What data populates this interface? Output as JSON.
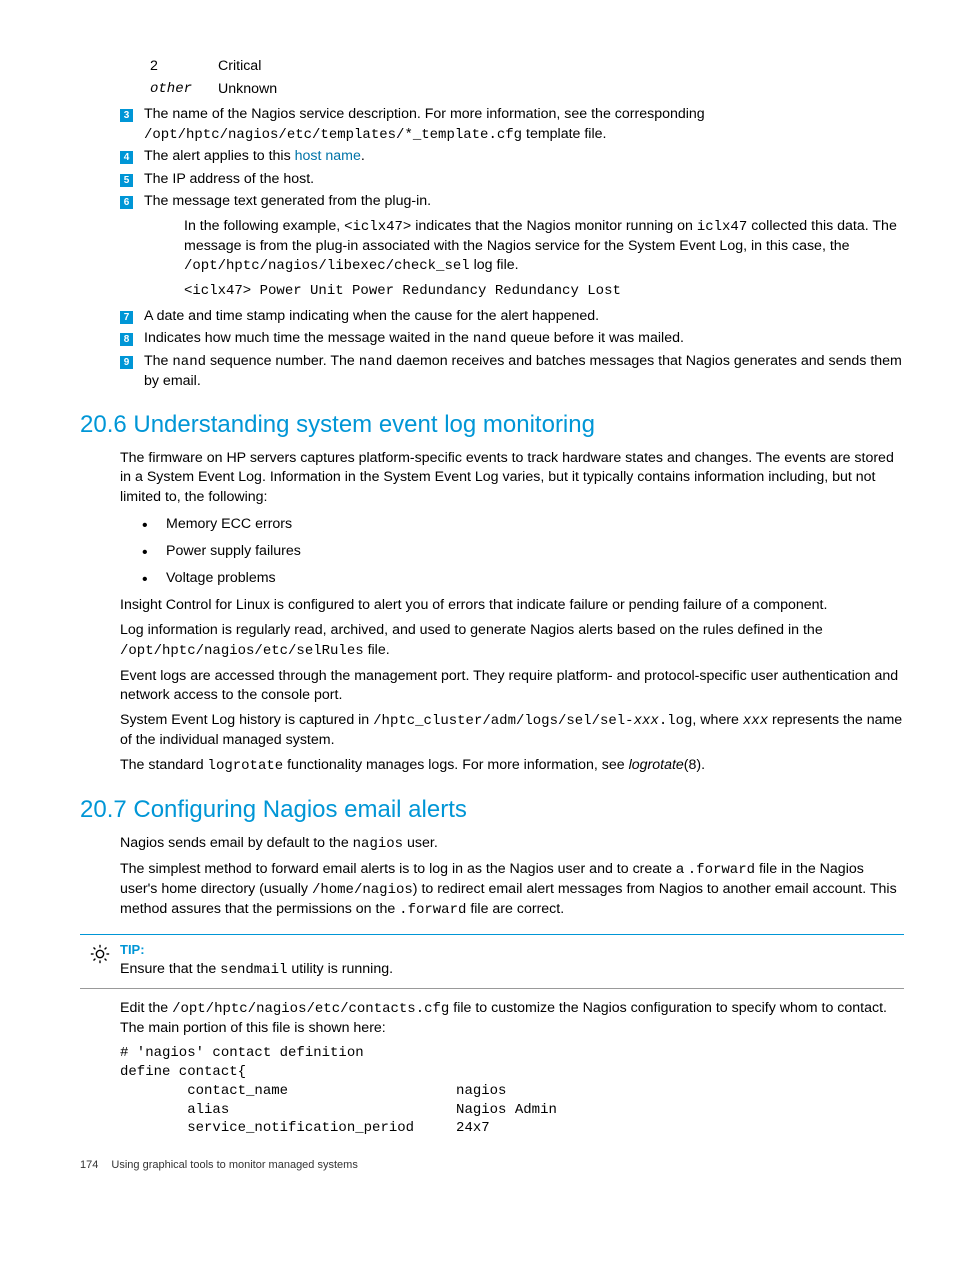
{
  "table": {
    "row1": {
      "key": "2",
      "val": "Critical"
    },
    "row2": {
      "key": "other",
      "val": "Unknown"
    }
  },
  "items": {
    "n3": "3",
    "t3a": "The name of the Nagios service description. For more information, see the corresponding ",
    "t3b": "/opt/hptc/nagios/etc/templates/*_template.cfg",
    "t3c": " template file.",
    "n4": "4",
    "t4a": "The alert applies to this ",
    "t4b": "host name",
    "t4c": ".",
    "n5": "5",
    "t5": "The IP address of the host.",
    "n6": "6",
    "t6": "The message text generated from the plug-in.",
    "ex_a": "In the following example, ",
    "ex_b": "<iclx47>",
    "ex_c": " indicates that the Nagios monitor running on ",
    "ex_d": "iclx47",
    "ex_e": " collected this data. The message is from the plug-in associated with the Nagios service for the System Event Log, in this case, the ",
    "ex_f": "/opt/hptc/nagios/libexec/check_sel",
    "ex_g": " log file.",
    "code6": "<iclx47> Power Unit Power Redundancy Redundancy Lost",
    "n7": "7",
    "t7": "A date and time stamp indicating when the cause for the alert happened.",
    "n8": "8",
    "t8a": "Indicates how much time the message waited in the ",
    "t8b": "nand",
    "t8c": " queue before it was mailed.",
    "n9": "9",
    "t9a": "The ",
    "t9b": "nand",
    "t9c": " sequence number. The ",
    "t9d": "nand",
    "t9e": " daemon receives and batches messages that Nagios generates and sends them by email."
  },
  "h206": "20.6 Understanding system event log monitoring",
  "s206": {
    "p1": "The firmware on HP servers captures platform-specific events to track hardware states and changes. The events are stored in a System Event Log. Information in the System Event Log varies, but it typically contains information including, but not limited to, the following:",
    "b1": "Memory ECC errors",
    "b2": "Power supply failures",
    "b3": "Voltage problems",
    "p2": "Insight Control for Linux is configured to alert you of errors that indicate failure or pending failure of a component.",
    "p3a": "Log information is regularly read, archived, and used to generate Nagios alerts based on the rules defined in the ",
    "p3b": "/opt/hptc/nagios/etc/selRules",
    "p3c": " file.",
    "p4": "Event logs are accessed through the management port. They require platform- and protocol-specific user authentication and network access to the console port.",
    "p5a": "System Event Log history is captured in ",
    "p5b": "/hptc_cluster/adm/logs/sel/sel-",
    "p5c": "xxx",
    "p5d": ".log",
    "p5e": ", where ",
    "p5f": "xxx",
    "p5g": " represents the name of the individual managed system.",
    "p6a": "The standard ",
    "p6b": "logrotate",
    "p6c": " functionality manages logs. For more information, see ",
    "p6d": "logrotate",
    "p6e": "(8)."
  },
  "h207": "20.7 Configuring Nagios email alerts",
  "s207": {
    "p1a": "Nagios sends email by default to the ",
    "p1b": "nagios",
    "p1c": " user.",
    "p2a": "The simplest method to forward email alerts is to log in as the Nagios user and to create a ",
    "p2b": ".forward",
    "p2c": " file in the Nagios user's home directory (usually ",
    "p2d": "/home/nagios",
    "p2e": ") to redirect email alert messages from Nagios to another email account. This method assures that the permissions on the ",
    "p2f": ".forward",
    "p2g": " file are correct."
  },
  "tip": {
    "label": "TIP:",
    "ta": "Ensure that the ",
    "tb": "sendmail",
    "tc": " utility is running."
  },
  "after": {
    "p1a": "Edit the ",
    "p1b": "/opt/hptc/nagios/etc/contacts.cfg",
    "p1c": " file to customize the Nagios configuration to specify whom to contact. The main portion of this file is shown here:",
    "code": "# 'nagios' contact definition\ndefine contact{\n        contact_name                    nagios\n        alias                           Nagios Admin\n        service_notification_period     24x7"
  },
  "footer": {
    "page": "174",
    "title": "Using graphical tools to monitor managed systems"
  }
}
